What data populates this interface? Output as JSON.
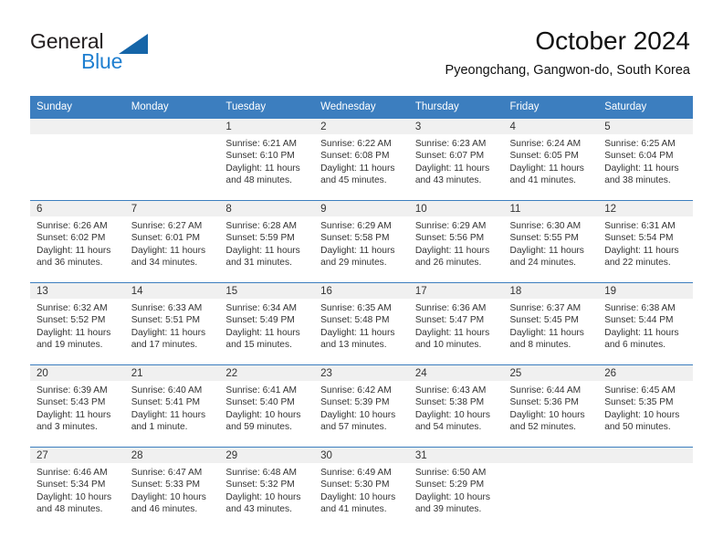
{
  "brand": {
    "name_top": "General",
    "name_bottom": "Blue",
    "triangle_color": "#1565a8",
    "blue_color": "#1f7fd0",
    "icon": "triangle-logo-icon"
  },
  "header": {
    "title": "October 2024",
    "subtitle": "Pyeongchang, Gangwon-do, South Korea"
  },
  "theme": {
    "header_blue": "#3c7ebf",
    "daynum_bg": "#f0f0f0",
    "text": "#333333"
  },
  "weekdays": [
    "Sunday",
    "Monday",
    "Tuesday",
    "Wednesday",
    "Thursday",
    "Friday",
    "Saturday"
  ],
  "weeks": [
    [
      {
        "day": "",
        "sunrise": "",
        "sunset": "",
        "daylight_line1": "",
        "daylight_line2": ""
      },
      {
        "day": "",
        "sunrise": "",
        "sunset": "",
        "daylight_line1": "",
        "daylight_line2": ""
      },
      {
        "day": "1",
        "sunrise": "Sunrise: 6:21 AM",
        "sunset": "Sunset: 6:10 PM",
        "daylight_line1": "Daylight: 11 hours",
        "daylight_line2": "and 48 minutes."
      },
      {
        "day": "2",
        "sunrise": "Sunrise: 6:22 AM",
        "sunset": "Sunset: 6:08 PM",
        "daylight_line1": "Daylight: 11 hours",
        "daylight_line2": "and 45 minutes."
      },
      {
        "day": "3",
        "sunrise": "Sunrise: 6:23 AM",
        "sunset": "Sunset: 6:07 PM",
        "daylight_line1": "Daylight: 11 hours",
        "daylight_line2": "and 43 minutes."
      },
      {
        "day": "4",
        "sunrise": "Sunrise: 6:24 AM",
        "sunset": "Sunset: 6:05 PM",
        "daylight_line1": "Daylight: 11 hours",
        "daylight_line2": "and 41 minutes."
      },
      {
        "day": "5",
        "sunrise": "Sunrise: 6:25 AM",
        "sunset": "Sunset: 6:04 PM",
        "daylight_line1": "Daylight: 11 hours",
        "daylight_line2": "and 38 minutes."
      }
    ],
    [
      {
        "day": "6",
        "sunrise": "Sunrise: 6:26 AM",
        "sunset": "Sunset: 6:02 PM",
        "daylight_line1": "Daylight: 11 hours",
        "daylight_line2": "and 36 minutes."
      },
      {
        "day": "7",
        "sunrise": "Sunrise: 6:27 AM",
        "sunset": "Sunset: 6:01 PM",
        "daylight_line1": "Daylight: 11 hours",
        "daylight_line2": "and 34 minutes."
      },
      {
        "day": "8",
        "sunrise": "Sunrise: 6:28 AM",
        "sunset": "Sunset: 5:59 PM",
        "daylight_line1": "Daylight: 11 hours",
        "daylight_line2": "and 31 minutes."
      },
      {
        "day": "9",
        "sunrise": "Sunrise: 6:29 AM",
        "sunset": "Sunset: 5:58 PM",
        "daylight_line1": "Daylight: 11 hours",
        "daylight_line2": "and 29 minutes."
      },
      {
        "day": "10",
        "sunrise": "Sunrise: 6:29 AM",
        "sunset": "Sunset: 5:56 PM",
        "daylight_line1": "Daylight: 11 hours",
        "daylight_line2": "and 26 minutes."
      },
      {
        "day": "11",
        "sunrise": "Sunrise: 6:30 AM",
        "sunset": "Sunset: 5:55 PM",
        "daylight_line1": "Daylight: 11 hours",
        "daylight_line2": "and 24 minutes."
      },
      {
        "day": "12",
        "sunrise": "Sunrise: 6:31 AM",
        "sunset": "Sunset: 5:54 PM",
        "daylight_line1": "Daylight: 11 hours",
        "daylight_line2": "and 22 minutes."
      }
    ],
    [
      {
        "day": "13",
        "sunrise": "Sunrise: 6:32 AM",
        "sunset": "Sunset: 5:52 PM",
        "daylight_line1": "Daylight: 11 hours",
        "daylight_line2": "and 19 minutes."
      },
      {
        "day": "14",
        "sunrise": "Sunrise: 6:33 AM",
        "sunset": "Sunset: 5:51 PM",
        "daylight_line1": "Daylight: 11 hours",
        "daylight_line2": "and 17 minutes."
      },
      {
        "day": "15",
        "sunrise": "Sunrise: 6:34 AM",
        "sunset": "Sunset: 5:49 PM",
        "daylight_line1": "Daylight: 11 hours",
        "daylight_line2": "and 15 minutes."
      },
      {
        "day": "16",
        "sunrise": "Sunrise: 6:35 AM",
        "sunset": "Sunset: 5:48 PM",
        "daylight_line1": "Daylight: 11 hours",
        "daylight_line2": "and 13 minutes."
      },
      {
        "day": "17",
        "sunrise": "Sunrise: 6:36 AM",
        "sunset": "Sunset: 5:47 PM",
        "daylight_line1": "Daylight: 11 hours",
        "daylight_line2": "and 10 minutes."
      },
      {
        "day": "18",
        "sunrise": "Sunrise: 6:37 AM",
        "sunset": "Sunset: 5:45 PM",
        "daylight_line1": "Daylight: 11 hours",
        "daylight_line2": "and 8 minutes."
      },
      {
        "day": "19",
        "sunrise": "Sunrise: 6:38 AM",
        "sunset": "Sunset: 5:44 PM",
        "daylight_line1": "Daylight: 11 hours",
        "daylight_line2": "and 6 minutes."
      }
    ],
    [
      {
        "day": "20",
        "sunrise": "Sunrise: 6:39 AM",
        "sunset": "Sunset: 5:43 PM",
        "daylight_line1": "Daylight: 11 hours",
        "daylight_line2": "and 3 minutes."
      },
      {
        "day": "21",
        "sunrise": "Sunrise: 6:40 AM",
        "sunset": "Sunset: 5:41 PM",
        "daylight_line1": "Daylight: 11 hours",
        "daylight_line2": "and 1 minute."
      },
      {
        "day": "22",
        "sunrise": "Sunrise: 6:41 AM",
        "sunset": "Sunset: 5:40 PM",
        "daylight_line1": "Daylight: 10 hours",
        "daylight_line2": "and 59 minutes."
      },
      {
        "day": "23",
        "sunrise": "Sunrise: 6:42 AM",
        "sunset": "Sunset: 5:39 PM",
        "daylight_line1": "Daylight: 10 hours",
        "daylight_line2": "and 57 minutes."
      },
      {
        "day": "24",
        "sunrise": "Sunrise: 6:43 AM",
        "sunset": "Sunset: 5:38 PM",
        "daylight_line1": "Daylight: 10 hours",
        "daylight_line2": "and 54 minutes."
      },
      {
        "day": "25",
        "sunrise": "Sunrise: 6:44 AM",
        "sunset": "Sunset: 5:36 PM",
        "daylight_line1": "Daylight: 10 hours",
        "daylight_line2": "and 52 minutes."
      },
      {
        "day": "26",
        "sunrise": "Sunrise: 6:45 AM",
        "sunset": "Sunset: 5:35 PM",
        "daylight_line1": "Daylight: 10 hours",
        "daylight_line2": "and 50 minutes."
      }
    ],
    [
      {
        "day": "27",
        "sunrise": "Sunrise: 6:46 AM",
        "sunset": "Sunset: 5:34 PM",
        "daylight_line1": "Daylight: 10 hours",
        "daylight_line2": "and 48 minutes."
      },
      {
        "day": "28",
        "sunrise": "Sunrise: 6:47 AM",
        "sunset": "Sunset: 5:33 PM",
        "daylight_line1": "Daylight: 10 hours",
        "daylight_line2": "and 46 minutes."
      },
      {
        "day": "29",
        "sunrise": "Sunrise: 6:48 AM",
        "sunset": "Sunset: 5:32 PM",
        "daylight_line1": "Daylight: 10 hours",
        "daylight_line2": "and 43 minutes."
      },
      {
        "day": "30",
        "sunrise": "Sunrise: 6:49 AM",
        "sunset": "Sunset: 5:30 PM",
        "daylight_line1": "Daylight: 10 hours",
        "daylight_line2": "and 41 minutes."
      },
      {
        "day": "31",
        "sunrise": "Sunrise: 6:50 AM",
        "sunset": "Sunset: 5:29 PM",
        "daylight_line1": "Daylight: 10 hours",
        "daylight_line2": "and 39 minutes."
      },
      {
        "day": "",
        "sunrise": "",
        "sunset": "",
        "daylight_line1": "",
        "daylight_line2": ""
      },
      {
        "day": "",
        "sunrise": "",
        "sunset": "",
        "daylight_line1": "",
        "daylight_line2": ""
      }
    ]
  ]
}
